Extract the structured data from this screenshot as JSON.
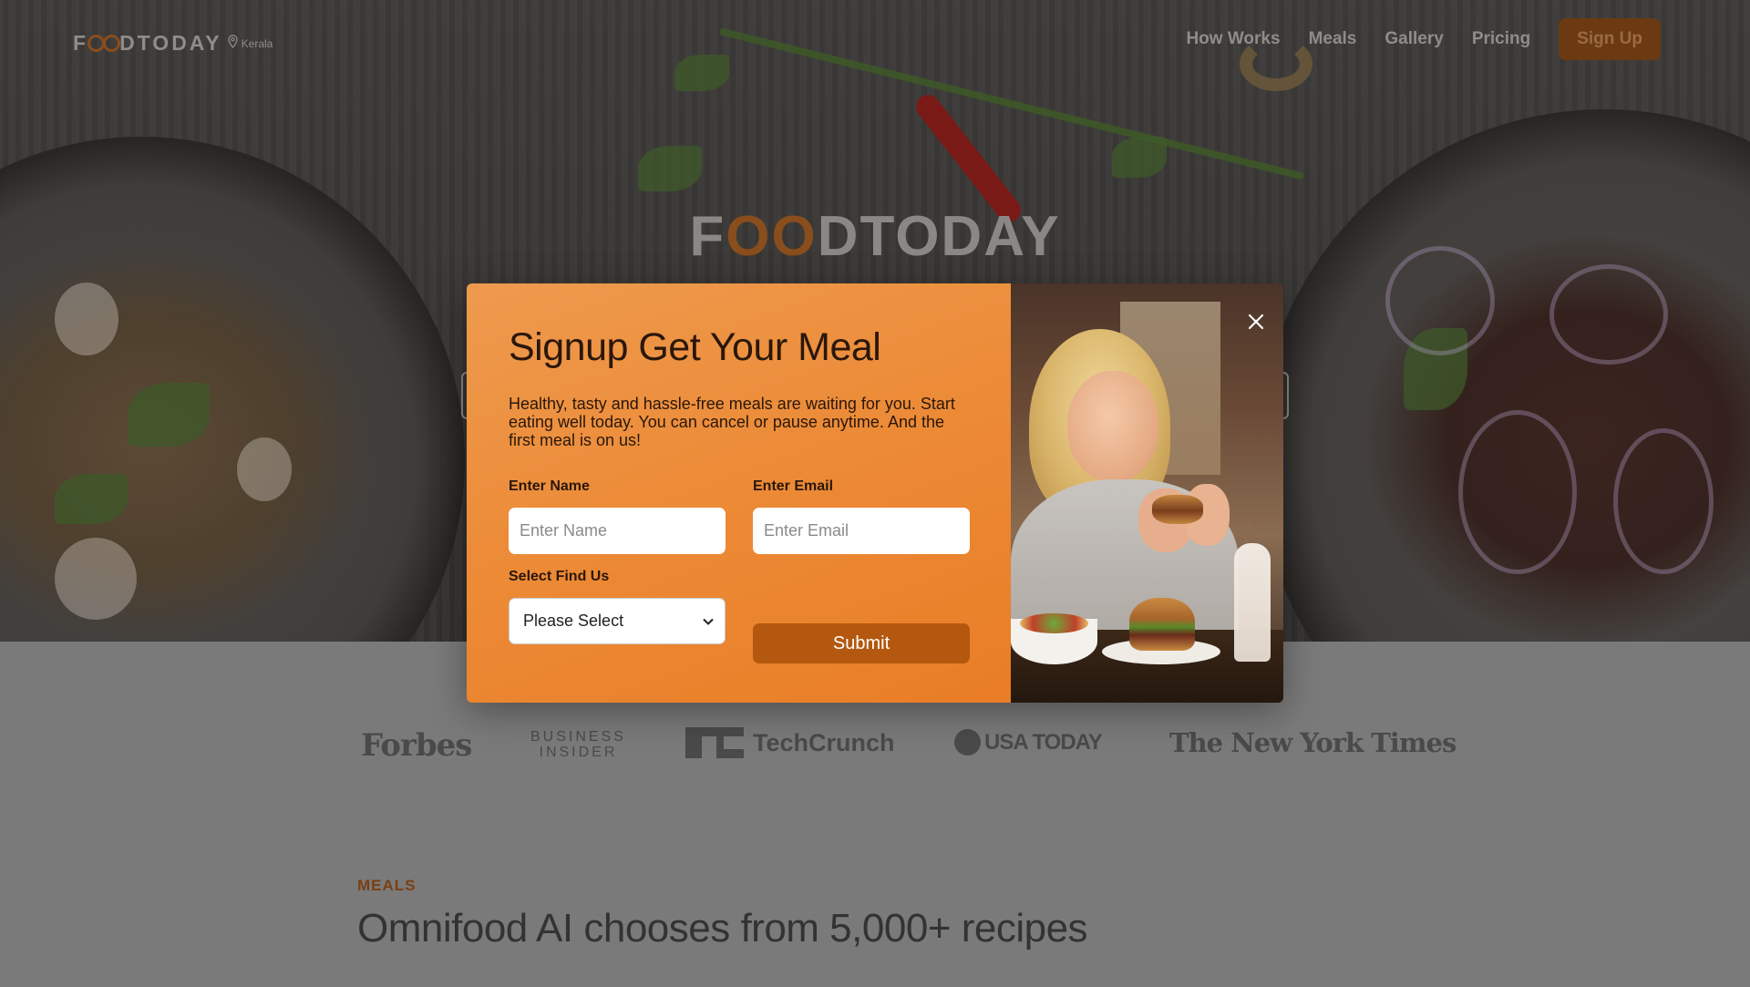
{
  "nav": {
    "logo_f": "F",
    "logo_rest": "DTODAY",
    "location": "Kerala",
    "links": [
      "How Works",
      "Meals",
      "Gallery",
      "Pricing"
    ],
    "signup_label": "Sign Up"
  },
  "hero": {
    "logo_f": "F",
    "logo_oo": "OO",
    "logo_rest": "DTODAY"
  },
  "modal": {
    "title": "Signup Get Your Meal",
    "text": "Healthy, tasty and hassle-free meals are waiting for you. Start eating well today. You can cancel or pause anytime. And the first meal is on us!",
    "name_label": "Enter Name",
    "name_placeholder": "Enter Name",
    "email_label": "Enter Email",
    "email_placeholder": "Enter Email",
    "select_label": "Select Find Us",
    "select_value": "Please Select",
    "submit_label": "Submit"
  },
  "press": {
    "forbes": "Forbes",
    "business_insider_1": "BUSINESS",
    "business_insider_2": "INSIDER",
    "techcrunch": "TechCrunch",
    "usa_today": "USA TODAY",
    "nyt": "The New York Times"
  },
  "section": {
    "kicker": "MEALS",
    "title": "Omnifood AI chooses from 5,000+ recipes"
  },
  "colors": {
    "accent": "#e98b35",
    "submit": "#b4580f",
    "nav_signup": "#6b3a12"
  },
  "icons": {
    "close": "close-icon",
    "location": "location-pin-icon",
    "select": "chevron-down-icon"
  }
}
